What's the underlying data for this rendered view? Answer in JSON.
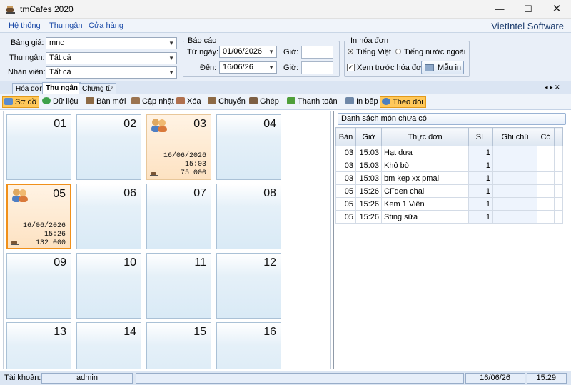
{
  "window": {
    "title": "tmCafes 2020"
  },
  "menu": {
    "items": [
      "Hệ thống",
      "Thu ngân",
      "Cửa hàng"
    ],
    "brand": "VietIntel Software"
  },
  "filters": {
    "bang_gia_label": "Bảng giá:",
    "bang_gia_value": "mnc",
    "thu_ngan_label": "Thu ngân:",
    "thu_ngan_value": "Tất cả",
    "nhan_vien_label": "Nhân viên:",
    "nhan_vien_value": "Tất cả",
    "bao_cao_title": "Báo cáo",
    "tu_ngay_label": "Từ ngày:",
    "tu_ngay_value": "01/06/2026",
    "den_label": "Đến:",
    "den_value": "16/06/26",
    "gio_label": "Giờ:",
    "in_hoa_don_title": "In hóa đơn",
    "radio_viet": "Tiếng Việt",
    "radio_foreign": "Tiếng nước ngoài",
    "preview_label": "Xem trước hóa đơn",
    "mau_in": "Mẫu in"
  },
  "tabs": [
    "Hóa đơn",
    "Thu ngân",
    "Chứng từ"
  ],
  "tabs_nav": "◂ ▸ ✕",
  "toolbar": [
    "Sơ đồ",
    "Dữ liệu",
    "Bàn mới",
    "Cập nhật",
    "Xóa",
    "Chuyển",
    "Ghép",
    "Thanh toán",
    "In bếp",
    "Theo dõi"
  ],
  "tables": [
    {
      "num": "01"
    },
    {
      "num": "02"
    },
    {
      "num": "03",
      "date": "16/06/2026",
      "time": "15:03",
      "amount": "75 000"
    },
    {
      "num": "04"
    },
    {
      "num": "05",
      "date": "16/06/2026",
      "time": "15:26",
      "amount": "132 000"
    },
    {
      "num": "06"
    },
    {
      "num": "07"
    },
    {
      "num": "08"
    },
    {
      "num": "09"
    },
    {
      "num": "10"
    },
    {
      "num": "11"
    },
    {
      "num": "12"
    },
    {
      "num": "13"
    },
    {
      "num": "14"
    },
    {
      "num": "15"
    },
    {
      "num": "16"
    }
  ],
  "orders": {
    "title": "Danh sách món chưa có",
    "columns": [
      "Bàn",
      "Giờ",
      "Thực đơn",
      "SL",
      "Ghi chú",
      "Có"
    ],
    "rows": [
      [
        "03",
        "15:03",
        "Hạt dưa",
        "1"
      ],
      [
        "03",
        "15:03",
        "Khô bò",
        "1"
      ],
      [
        "03",
        "15:03",
        "bm kep xx pmai",
        "1"
      ],
      [
        "05",
        "15:26",
        "CFden chai",
        "1"
      ],
      [
        "05",
        "15:26",
        "Kem 1 Viên",
        "1"
      ],
      [
        "05",
        "15:26",
        "Sting sữa",
        "1"
      ]
    ]
  },
  "status": {
    "account_label": "Tài khoản:",
    "account": "admin",
    "date": "16/06/26",
    "time": "15:29"
  },
  "colors": {
    "accent": "#f0901a",
    "header": "#1747a6"
  }
}
